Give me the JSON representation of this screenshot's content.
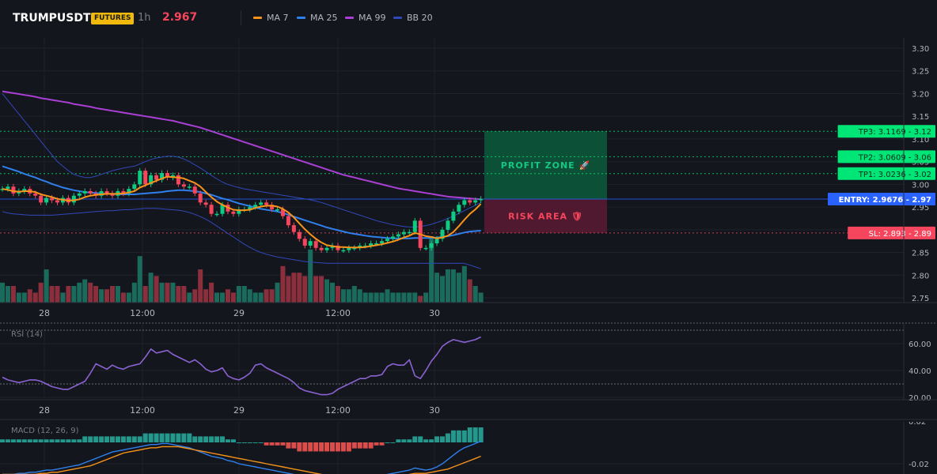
{
  "header": {
    "symbol": "TRUMPUSDT",
    "market": "FUTURES",
    "interval": "1h",
    "last_price": "2.967",
    "legend": [
      {
        "label": "MA 7",
        "color": "#f7931a"
      },
      {
        "label": "MA 25",
        "color": "#2f80ed"
      },
      {
        "label": "MA 99",
        "color": "#a93fd4"
      },
      {
        "label": "BB 20",
        "color": "#3048b8"
      }
    ]
  },
  "colors": {
    "background": "#14161d",
    "bull": "#0ecb81",
    "bear": "#f6465d",
    "vol_bull": "#1b6b5c",
    "vol_bear": "#8c2f3d",
    "ma7": "#f7931a",
    "ma25": "#2f80ed",
    "ma99": "#a93fd4",
    "bb": "#3048b8",
    "rsi": "#8a63d2",
    "macd_line": "#2f80ed",
    "signal_line": "#f7931a",
    "tp": "#00e676",
    "sl": "#f6465d",
    "entry": "#2962ff"
  },
  "x_labels": [
    "28",
    "12:00",
    "29",
    "12:00",
    "30"
  ],
  "y_labels": [
    "3.30",
    "3.25",
    "3.20",
    "3.15",
    "3.10",
    "3.05",
    "3.00",
    "2.95",
    "2.90",
    "2.85",
    "2.80",
    "2.75"
  ],
  "levels": [
    {
      "kind": "tp",
      "price": 3.1169,
      "label": "TP3: 3.1169",
      "axis": "3.12"
    },
    {
      "kind": "tp",
      "price": 3.0609,
      "label": "TP2: 3.0609",
      "axis": "3.06"
    },
    {
      "kind": "tp",
      "price": 3.0236,
      "label": "TP1: 3.0236",
      "axis": "3.02"
    },
    {
      "kind": "entry",
      "price": 2.9676,
      "label": "ENTRY: 2.9676",
      "axis": "2.97"
    },
    {
      "kind": "sl",
      "price": 2.893,
      "label": "SL: 2.893",
      "axis": "2.89"
    }
  ],
  "zones": {
    "profit_label": "PROFIT ZONE 🚀",
    "risk_label": "RISK AREA 🛡"
  },
  "rsi": {
    "label": "RSI (14)",
    "axis": [
      "60.00",
      "40.00",
      "20.00"
    ],
    "values": [
      35,
      33,
      32,
      31,
      32,
      33,
      33,
      32,
      30,
      28,
      27,
      26,
      26,
      28,
      30,
      32,
      38,
      45,
      43,
      41,
      44,
      42,
      41,
      43,
      44,
      45,
      50,
      56,
      53,
      54,
      55,
      52,
      50,
      48,
      46,
      48,
      45,
      41,
      39,
      40,
      42,
      36,
      34,
      33,
      35,
      38,
      44,
      45,
      42,
      40,
      38,
      36,
      34,
      31,
      27,
      25,
      24,
      23,
      22,
      22,
      23,
      26,
      28,
      30,
      32,
      34,
      34,
      36,
      36,
      37,
      43,
      45,
      44,
      44,
      48,
      36,
      34,
      40,
      47,
      52,
      58,
      61,
      63,
      62,
      61,
      62,
      63,
      65
    ],
    "x_labels": [
      "28",
      "12:00",
      "29",
      "12:00",
      "30"
    ]
  },
  "macd": {
    "label": "MACD (12, 26, 9)",
    "axis": [
      "0.02",
      "-0.02"
    ]
  },
  "chart_data": {
    "type": "candlestick",
    "timeframe": "1h",
    "ylim": [
      2.74,
      3.32
    ],
    "open": [
      2.99,
      2.99,
      2.995,
      2.98,
      2.985,
      2.99,
      2.98,
      2.975,
      2.96,
      2.97,
      2.965,
      2.96,
      2.97,
      2.96,
      2.975,
      2.98,
      2.985,
      2.98,
      2.975,
      2.985,
      2.98,
      2.975,
      2.985,
      2.98,
      2.99,
      3.0,
      3.03,
      3.0,
      3.02,
      3.01,
      3.025,
      3.015,
      3.02,
      3.0,
      2.995,
      2.995,
      2.98,
      2.96,
      2.955,
      2.935,
      2.935,
      2.955,
      2.94,
      2.935,
      2.945,
      2.945,
      2.95,
      2.955,
      2.96,
      2.955,
      2.945,
      2.945,
      2.93,
      2.91,
      2.895,
      2.88,
      2.865,
      2.875,
      2.86,
      2.855,
      2.86,
      2.865,
      2.855,
      2.855,
      2.86,
      2.86,
      2.865,
      2.865,
      2.87,
      2.87,
      2.875,
      2.88,
      2.885,
      2.89,
      2.895,
      2.895,
      2.92,
      2.86,
      2.86,
      2.87,
      2.88,
      2.9,
      2.92,
      2.94,
      2.955,
      2.965,
      2.96,
      2.965
    ],
    "close": [
      2.99,
      2.995,
      2.98,
      2.985,
      2.99,
      2.98,
      2.975,
      2.96,
      2.97,
      2.965,
      2.96,
      2.97,
      2.96,
      2.975,
      2.98,
      2.985,
      2.98,
      2.975,
      2.985,
      2.98,
      2.975,
      2.985,
      2.98,
      2.99,
      3.0,
      3.03,
      3.0,
      3.02,
      3.01,
      3.025,
      3.015,
      3.02,
      3.0,
      2.995,
      2.995,
      2.98,
      2.96,
      2.955,
      2.935,
      2.935,
      2.955,
      2.94,
      2.935,
      2.945,
      2.945,
      2.95,
      2.955,
      2.96,
      2.955,
      2.945,
      2.945,
      2.93,
      2.91,
      2.895,
      2.88,
      2.865,
      2.875,
      2.86,
      2.855,
      2.86,
      2.865,
      2.855,
      2.855,
      2.86,
      2.86,
      2.865,
      2.865,
      2.87,
      2.87,
      2.875,
      2.88,
      2.885,
      2.89,
      2.895,
      2.895,
      2.92,
      2.86,
      2.86,
      2.87,
      2.88,
      2.9,
      2.92,
      2.94,
      2.955,
      2.965,
      2.96,
      2.965,
      2.968
    ],
    "volume": [
      0.6,
      0.5,
      0.5,
      0.3,
      0.3,
      0.4,
      0.3,
      0.6,
      1.0,
      0.5,
      0.5,
      0.3,
      0.5,
      0.5,
      0.6,
      0.7,
      0.6,
      0.5,
      0.4,
      0.4,
      0.5,
      0.5,
      0.3,
      0.3,
      0.6,
      1.4,
      0.5,
      0.9,
      0.8,
      0.6,
      0.6,
      0.6,
      0.5,
      0.5,
      0.3,
      0.4,
      1.0,
      0.4,
      0.6,
      0.3,
      0.3,
      0.4,
      0.3,
      0.5,
      0.5,
      0.4,
      0.3,
      0.3,
      0.4,
      0.4,
      0.6,
      1.1,
      0.8,
      0.9,
      0.9,
      0.8,
      1.6,
      0.8,
      0.8,
      0.7,
      0.6,
      0.5,
      0.4,
      0.4,
      0.5,
      0.4,
      0.3,
      0.3,
      0.3,
      0.3,
      0.4,
      0.3,
      0.3,
      0.3,
      0.3,
      0.3,
      0.2,
      0.3,
      2.0,
      0.9,
      0.8,
      1.0,
      1.0,
      0.9,
      1.1,
      0.7,
      0.5,
      0.3
    ],
    "ma7": [
      2.99,
      2.988,
      2.985,
      2.984,
      2.985,
      2.985,
      2.983,
      2.978,
      2.975,
      2.972,
      2.968,
      2.966,
      2.964,
      2.965,
      2.967,
      2.972,
      2.975,
      2.977,
      2.978,
      2.979,
      2.979,
      2.979,
      2.98,
      2.982,
      2.985,
      2.993,
      2.998,
      3.003,
      3.008,
      3.013,
      3.017,
      3.016,
      3.015,
      3.013,
      3.008,
      3.003,
      2.995,
      2.983,
      2.972,
      2.962,
      2.955,
      2.949,
      2.944,
      2.943,
      2.943,
      2.944,
      2.948,
      2.951,
      2.953,
      2.953,
      2.951,
      2.946,
      2.938,
      2.927,
      2.914,
      2.901,
      2.89,
      2.88,
      2.872,
      2.866,
      2.864,
      2.862,
      2.862,
      2.861,
      2.861,
      2.861,
      2.862,
      2.864,
      2.866,
      2.868,
      2.871,
      2.874,
      2.878,
      2.883,
      2.887,
      2.893,
      2.89,
      2.886,
      2.884,
      2.881,
      2.883,
      2.887,
      2.895,
      2.908,
      2.922,
      2.935,
      2.945,
      2.957
    ],
    "ma25": [
      3.04,
      3.036,
      3.032,
      3.028,
      3.023,
      3.019,
      3.015,
      3.01,
      3.006,
      3.001,
      2.997,
      2.993,
      2.99,
      2.987,
      2.985,
      2.983,
      2.982,
      2.981,
      2.98,
      2.979,
      2.979,
      2.978,
      2.978,
      2.978,
      2.978,
      2.979,
      2.98,
      2.981,
      2.982,
      2.983,
      2.985,
      2.986,
      2.987,
      2.987,
      2.986,
      2.985,
      2.983,
      2.98,
      2.977,
      2.973,
      2.969,
      2.966,
      2.962,
      2.958,
      2.955,
      2.952,
      2.949,
      2.946,
      2.944,
      2.942,
      2.94,
      2.937,
      2.933,
      2.929,
      2.925,
      2.921,
      2.917,
      2.913,
      2.909,
      2.905,
      2.902,
      2.899,
      2.896,
      2.893,
      2.891,
      2.889,
      2.887,
      2.885,
      2.884,
      2.883,
      2.882,
      2.881,
      2.881,
      2.881,
      2.881,
      2.882,
      2.882,
      2.882,
      2.882,
      2.883,
      2.884,
      2.886,
      2.888,
      2.891,
      2.894,
      2.896,
      2.897,
      2.898
    ],
    "ma99": [
      3.205,
      3.203,
      3.201,
      3.199,
      3.197,
      3.195,
      3.193,
      3.19,
      3.188,
      3.186,
      3.184,
      3.182,
      3.18,
      3.177,
      3.175,
      3.173,
      3.171,
      3.168,
      3.166,
      3.164,
      3.162,
      3.16,
      3.158,
      3.156,
      3.154,
      3.152,
      3.15,
      3.148,
      3.146,
      3.144,
      3.142,
      3.14,
      3.137,
      3.134,
      3.131,
      3.128,
      3.125,
      3.121,
      3.117,
      3.113,
      3.109,
      3.105,
      3.101,
      3.097,
      3.093,
      3.089,
      3.085,
      3.081,
      3.077,
      3.073,
      3.069,
      3.065,
      3.061,
      3.057,
      3.053,
      3.049,
      3.045,
      3.041,
      3.037,
      3.033,
      3.029,
      3.025,
      3.021,
      3.018,
      3.015,
      3.012,
      3.009,
      3.006,
      3.003,
      3.0,
      2.997,
      2.994,
      2.991,
      2.989,
      2.987,
      2.985,
      2.983,
      2.981,
      2.979,
      2.977,
      2.975,
      2.973,
      2.972,
      2.971,
      2.97,
      2.969,
      2.968,
      2.967
    ],
    "bb_upper": [
      3.2,
      3.185,
      3.17,
      3.155,
      3.14,
      3.125,
      3.11,
      3.095,
      3.08,
      3.065,
      3.05,
      3.04,
      3.03,
      3.022,
      3.018,
      3.015,
      3.015,
      3.018,
      3.022,
      3.026,
      3.03,
      3.033,
      3.036,
      3.038,
      3.04,
      3.045,
      3.05,
      3.055,
      3.058,
      3.06,
      3.062,
      3.062,
      3.06,
      3.056,
      3.05,
      3.043,
      3.036,
      3.028,
      3.02,
      3.012,
      3.005,
      3.0,
      2.996,
      2.993,
      2.99,
      2.988,
      2.986,
      2.984,
      2.982,
      2.98,
      2.978,
      2.976,
      2.974,
      2.972,
      2.97,
      2.968,
      2.966,
      2.963,
      2.96,
      2.956,
      2.952,
      2.948,
      2.944,
      2.94,
      2.936,
      2.932,
      2.928,
      2.924,
      2.92,
      2.917,
      2.914,
      2.911,
      2.909,
      2.907,
      2.906,
      2.906,
      2.907,
      2.909,
      2.912,
      2.916,
      2.92,
      2.925,
      2.93,
      2.936,
      2.942,
      2.948,
      2.954,
      2.96
    ],
    "bb_lower": [
      2.94,
      2.937,
      2.935,
      2.934,
      2.933,
      2.932,
      2.932,
      2.932,
      2.932,
      2.932,
      2.933,
      2.934,
      2.935,
      2.936,
      2.937,
      2.938,
      2.939,
      2.94,
      2.941,
      2.942,
      2.942,
      2.943,
      2.944,
      2.944,
      2.945,
      2.946,
      2.947,
      2.947,
      2.947,
      2.946,
      2.945,
      2.944,
      2.943,
      2.941,
      2.938,
      2.934,
      2.929,
      2.923,
      2.916,
      2.908,
      2.9,
      2.892,
      2.884,
      2.876,
      2.868,
      2.861,
      2.855,
      2.85,
      2.846,
      2.843,
      2.84,
      2.838,
      2.836,
      2.834,
      2.832,
      2.83,
      2.829,
      2.828,
      2.827,
      2.826,
      2.826,
      2.826,
      2.826,
      2.826,
      2.826,
      2.826,
      2.826,
      2.826,
      2.826,
      2.826,
      2.826,
      2.826,
      2.826,
      2.826,
      2.826,
      2.826,
      2.826,
      2.826,
      2.826,
      2.826,
      2.826,
      2.826,
      2.826,
      2.826,
      2.826,
      2.822,
      2.818,
      2.814
    ],
    "macd_hist": [
      0.001,
      0.001,
      0.001,
      0.001,
      0.001,
      0.001,
      0.001,
      0.001,
      0.001,
      0.001,
      0.001,
      0.001,
      0.001,
      0.001,
      0.001,
      0.002,
      0.002,
      0.002,
      0.002,
      0.002,
      0.002,
      0.002,
      0.002,
      0.002,
      0.002,
      0.002,
      0.003,
      0.003,
      0.003,
      0.003,
      0.003,
      0.003,
      0.003,
      0.003,
      0.003,
      0.002,
      0.002,
      0.002,
      0.002,
      0.002,
      0.002,
      0.001,
      0.001,
      0.0,
      0.0,
      0.0,
      0.0,
      0.0,
      -0.001,
      -0.001,
      -0.001,
      -0.001,
      -0.002,
      -0.002,
      -0.003,
      -0.003,
      -0.003,
      -0.003,
      -0.003,
      -0.003,
      -0.003,
      -0.003,
      -0.003,
      -0.003,
      -0.002,
      -0.002,
      -0.002,
      -0.002,
      -0.001,
      -0.001,
      0.0,
      0.0,
      0.001,
      0.001,
      0.001,
      0.002,
      0.002,
      0.001,
      0.001,
      0.002,
      0.002,
      0.003,
      0.004,
      0.004,
      0.004,
      0.005,
      0.005,
      0.005
    ],
    "macd_line": [
      -0.03,
      -0.03,
      -0.03,
      -0.029,
      -0.029,
      -0.028,
      -0.028,
      -0.027,
      -0.026,
      -0.026,
      -0.025,
      -0.024,
      -0.023,
      -0.022,
      -0.021,
      -0.019,
      -0.017,
      -0.015,
      -0.013,
      -0.011,
      -0.009,
      -0.008,
      -0.007,
      -0.006,
      -0.005,
      -0.004,
      -0.003,
      -0.002,
      -0.002,
      -0.001,
      -0.001,
      -0.002,
      -0.003,
      -0.004,
      -0.005,
      -0.007,
      -0.009,
      -0.011,
      -0.013,
      -0.014,
      -0.015,
      -0.017,
      -0.018,
      -0.02,
      -0.021,
      -0.022,
      -0.023,
      -0.024,
      -0.025,
      -0.026,
      -0.027,
      -0.028,
      -0.029,
      -0.03,
      -0.032,
      -0.033,
      -0.034,
      -0.035,
      -0.036,
      -0.036,
      -0.037,
      -0.037,
      -0.037,
      -0.036,
      -0.036,
      -0.035,
      -0.034,
      -0.033,
      -0.032,
      -0.031,
      -0.03,
      -0.029,
      -0.028,
      -0.027,
      -0.026,
      -0.024,
      -0.025,
      -0.026,
      -0.025,
      -0.023,
      -0.02,
      -0.016,
      -0.012,
      -0.008,
      -0.005,
      -0.003,
      -0.001,
      0.001
    ],
    "signal_line": [
      -0.03,
      -0.03,
      -0.03,
      -0.03,
      -0.03,
      -0.03,
      -0.03,
      -0.029,
      -0.029,
      -0.028,
      -0.028,
      -0.027,
      -0.026,
      -0.025,
      -0.024,
      -0.023,
      -0.022,
      -0.02,
      -0.018,
      -0.016,
      -0.014,
      -0.012,
      -0.01,
      -0.009,
      -0.008,
      -0.007,
      -0.006,
      -0.005,
      -0.005,
      -0.004,
      -0.004,
      -0.004,
      -0.004,
      -0.005,
      -0.006,
      -0.007,
      -0.008,
      -0.009,
      -0.01,
      -0.011,
      -0.012,
      -0.013,
      -0.014,
      -0.015,
      -0.016,
      -0.017,
      -0.018,
      -0.019,
      -0.02,
      -0.021,
      -0.022,
      -0.023,
      -0.024,
      -0.025,
      -0.026,
      -0.027,
      -0.028,
      -0.029,
      -0.03,
      -0.031,
      -0.032,
      -0.033,
      -0.033,
      -0.034,
      -0.034,
      -0.034,
      -0.034,
      -0.034,
      -0.033,
      -0.033,
      -0.032,
      -0.032,
      -0.031,
      -0.031,
      -0.03,
      -0.029,
      -0.029,
      -0.029,
      -0.028,
      -0.027,
      -0.026,
      -0.025,
      -0.023,
      -0.021,
      -0.019,
      -0.017,
      -0.015,
      -0.013
    ]
  }
}
